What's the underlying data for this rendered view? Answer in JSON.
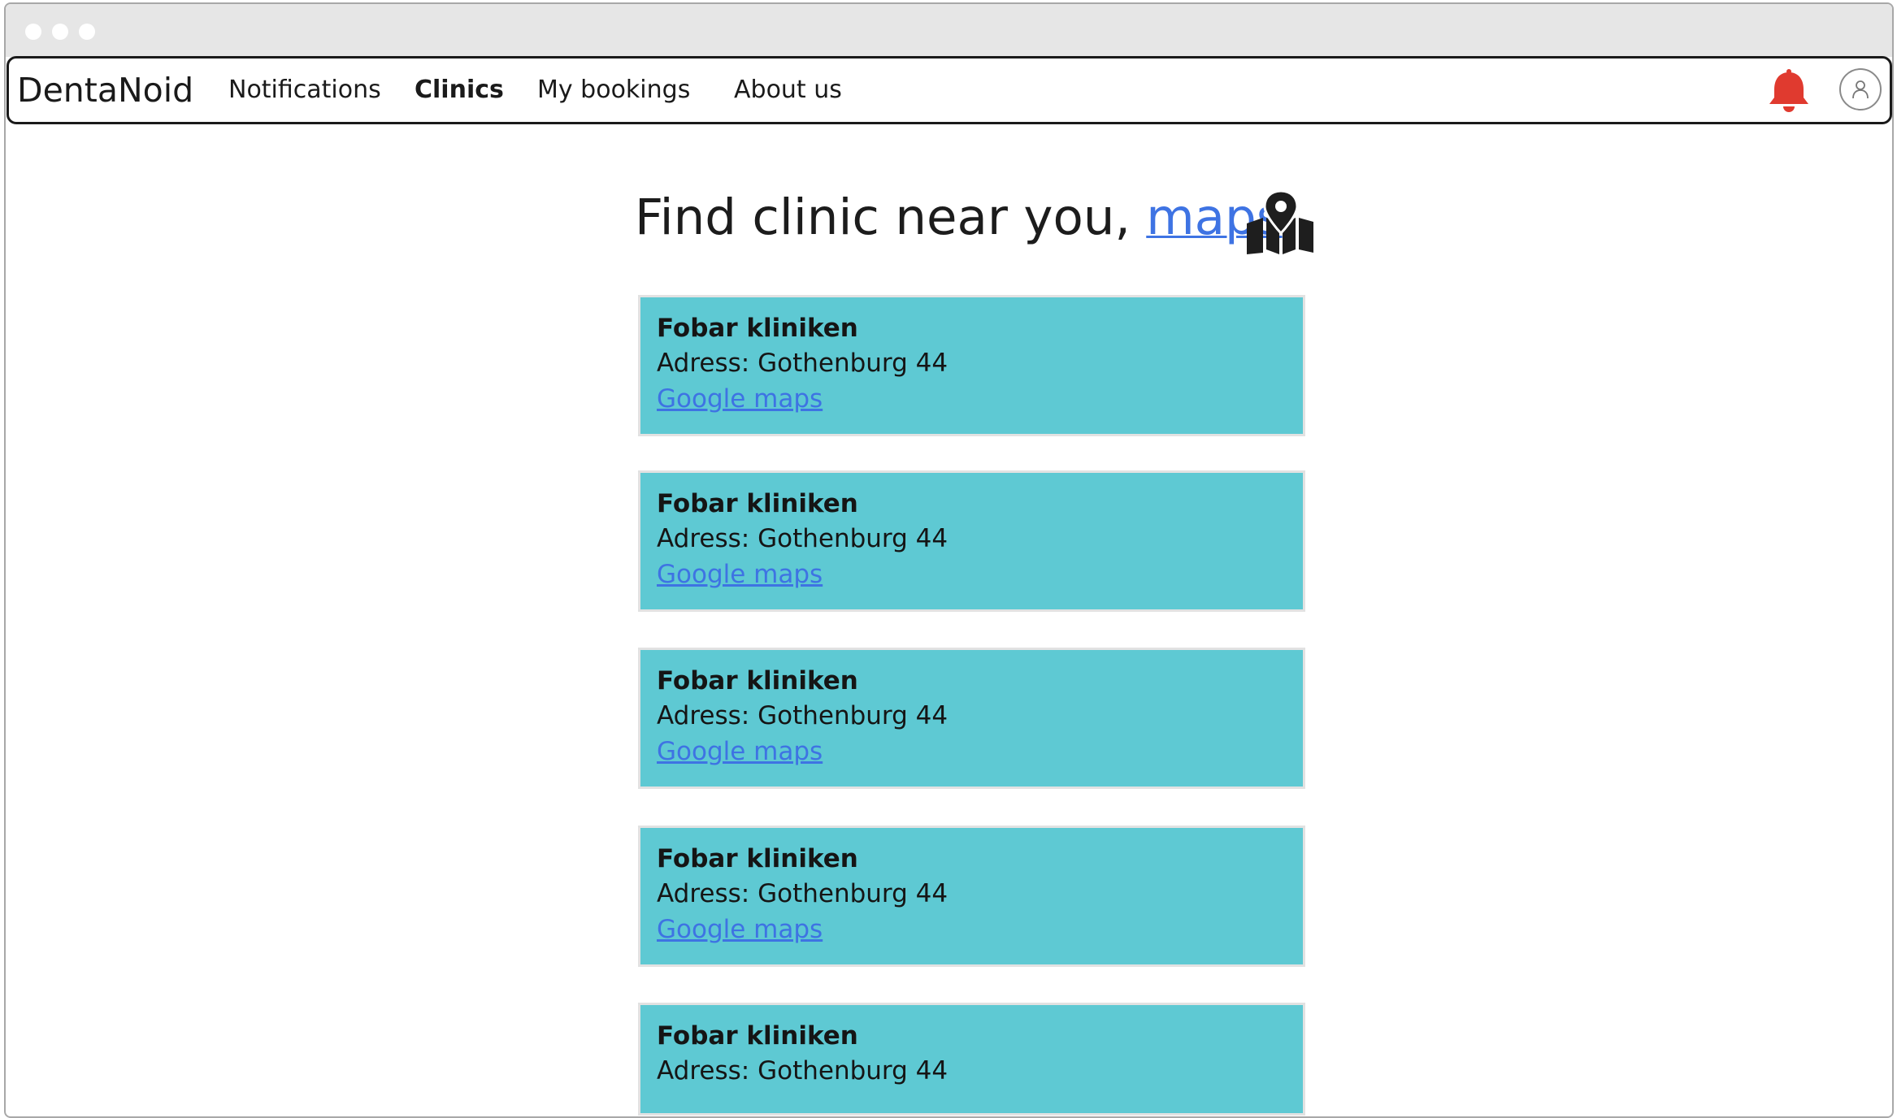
{
  "navbar": {
    "brand": "DentaNoid",
    "items": [
      {
        "label": "Notifications"
      },
      {
        "label": "Clinics",
        "active": true
      },
      {
        "label": "My bookings"
      },
      {
        "label": "About us"
      }
    ],
    "bell_color": "#e03a2f"
  },
  "heading": {
    "text": "Find clinic near you, ",
    "link": "maps"
  },
  "clinics": [
    {
      "name": "Fobar kliniken",
      "address": "Adress: Gothenburg 44",
      "link": "Google maps"
    },
    {
      "name": "Fobar kliniken",
      "address": "Adress: Gothenburg 44",
      "link": "Google maps"
    },
    {
      "name": "Fobar kliniken",
      "address": "Adress: Gothenburg 44",
      "link": "Google maps"
    },
    {
      "name": "Fobar kliniken",
      "address": "Adress: Gothenburg 44",
      "link": "Google maps"
    },
    {
      "name": "Fobar kliniken",
      "address": "Adress: Gothenburg 44",
      "link": ""
    }
  ],
  "colors": {
    "card_background": "#5ec9d3",
    "link": "#3e73e3"
  }
}
